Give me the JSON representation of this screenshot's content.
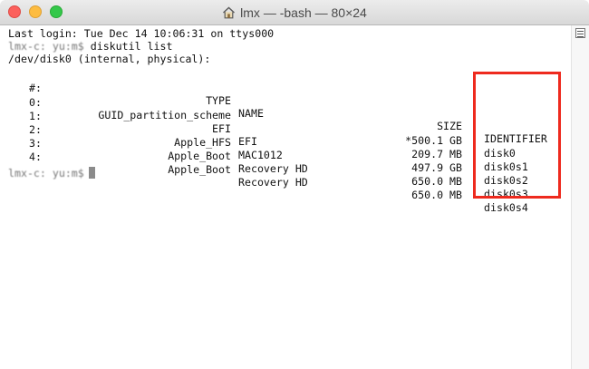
{
  "window": {
    "title": "lmx — -bash — 80×24",
    "home_icon": "house-icon"
  },
  "terminal": {
    "login_line": "Last login: Tue Dec 14 10:06:31 on ttys000",
    "prompt_prefix": "lmx-c: yu:m$",
    "command": " diskutil list",
    "device_line": "/dev/disk0 (internal, physical):",
    "header": {
      "num": "#:",
      "type": "TYPE",
      "name": "NAME",
      "size": "SIZE",
      "identifier": "IDENTIFIER"
    },
    "rows": [
      {
        "num": "0:",
        "type": "GUID_partition_scheme",
        "name": "",
        "size": "*500.1 GB",
        "identifier": "disk0"
      },
      {
        "num": "1:",
        "type": "EFI",
        "name": "EFI",
        "size": "209.7 MB",
        "identifier": "disk0s1"
      },
      {
        "num": "2:",
        "type": "Apple_HFS",
        "name": "MAC1012",
        "size": "497.9 GB",
        "identifier": "disk0s2"
      },
      {
        "num": "3:",
        "type": "Apple_Boot",
        "name": "Recovery HD",
        "size": "650.0 MB",
        "identifier": "disk0s3"
      },
      {
        "num": "4:",
        "type": "Apple_Boot",
        "name": "Recovery HD",
        "size": "650.0 MB",
        "identifier": "disk0s4"
      }
    ],
    "final_prompt": "lmx-c: yu:m$"
  },
  "colors": {
    "highlight": "#ee2a1e",
    "close": "#fc605c",
    "minimize": "#fdbc40",
    "zoom": "#34c84a"
  }
}
